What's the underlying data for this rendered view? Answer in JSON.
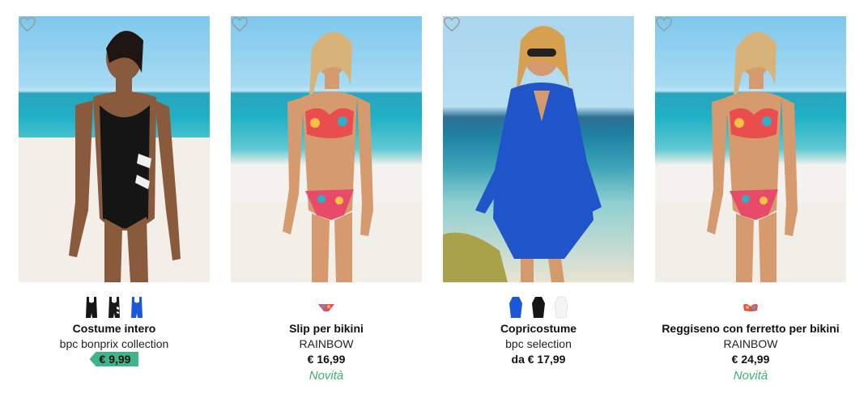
{
  "products": [
    {
      "title": "Costume intero",
      "brand": "bpc bonprix collection",
      "price": "€ 9,99",
      "price_style": "sale",
      "badge": "",
      "swatches": [
        "black-swimsuit",
        "black-white-swimsuit",
        "blue-swimsuit"
      ]
    },
    {
      "title": "Slip per bikini",
      "brand": "RAINBOW",
      "price": "€ 16,99",
      "price_style": "plain",
      "badge": "Novità",
      "swatches": [
        "multicolor-bikini-bottom"
      ]
    },
    {
      "title": "Copricostume",
      "brand": "bpc selection",
      "price": "da € 17,99",
      "price_style": "plain",
      "badge": "",
      "swatches": [
        "blue-coverup",
        "black-coverup",
        "white-coverup"
      ]
    },
    {
      "title": "Reggiseno con ferretto per bikini",
      "brand": "RAINBOW",
      "price": "€ 24,99",
      "price_style": "plain",
      "badge": "Novità",
      "swatches": [
        "multicolor-bikini-top"
      ]
    }
  ],
  "colors": {
    "sale_tag": "#3eb489",
    "novita_text": "#3fae6f",
    "heart_outline": "#9a9a9a"
  },
  "icons": {
    "wishlist": "heart-outline-icon"
  }
}
